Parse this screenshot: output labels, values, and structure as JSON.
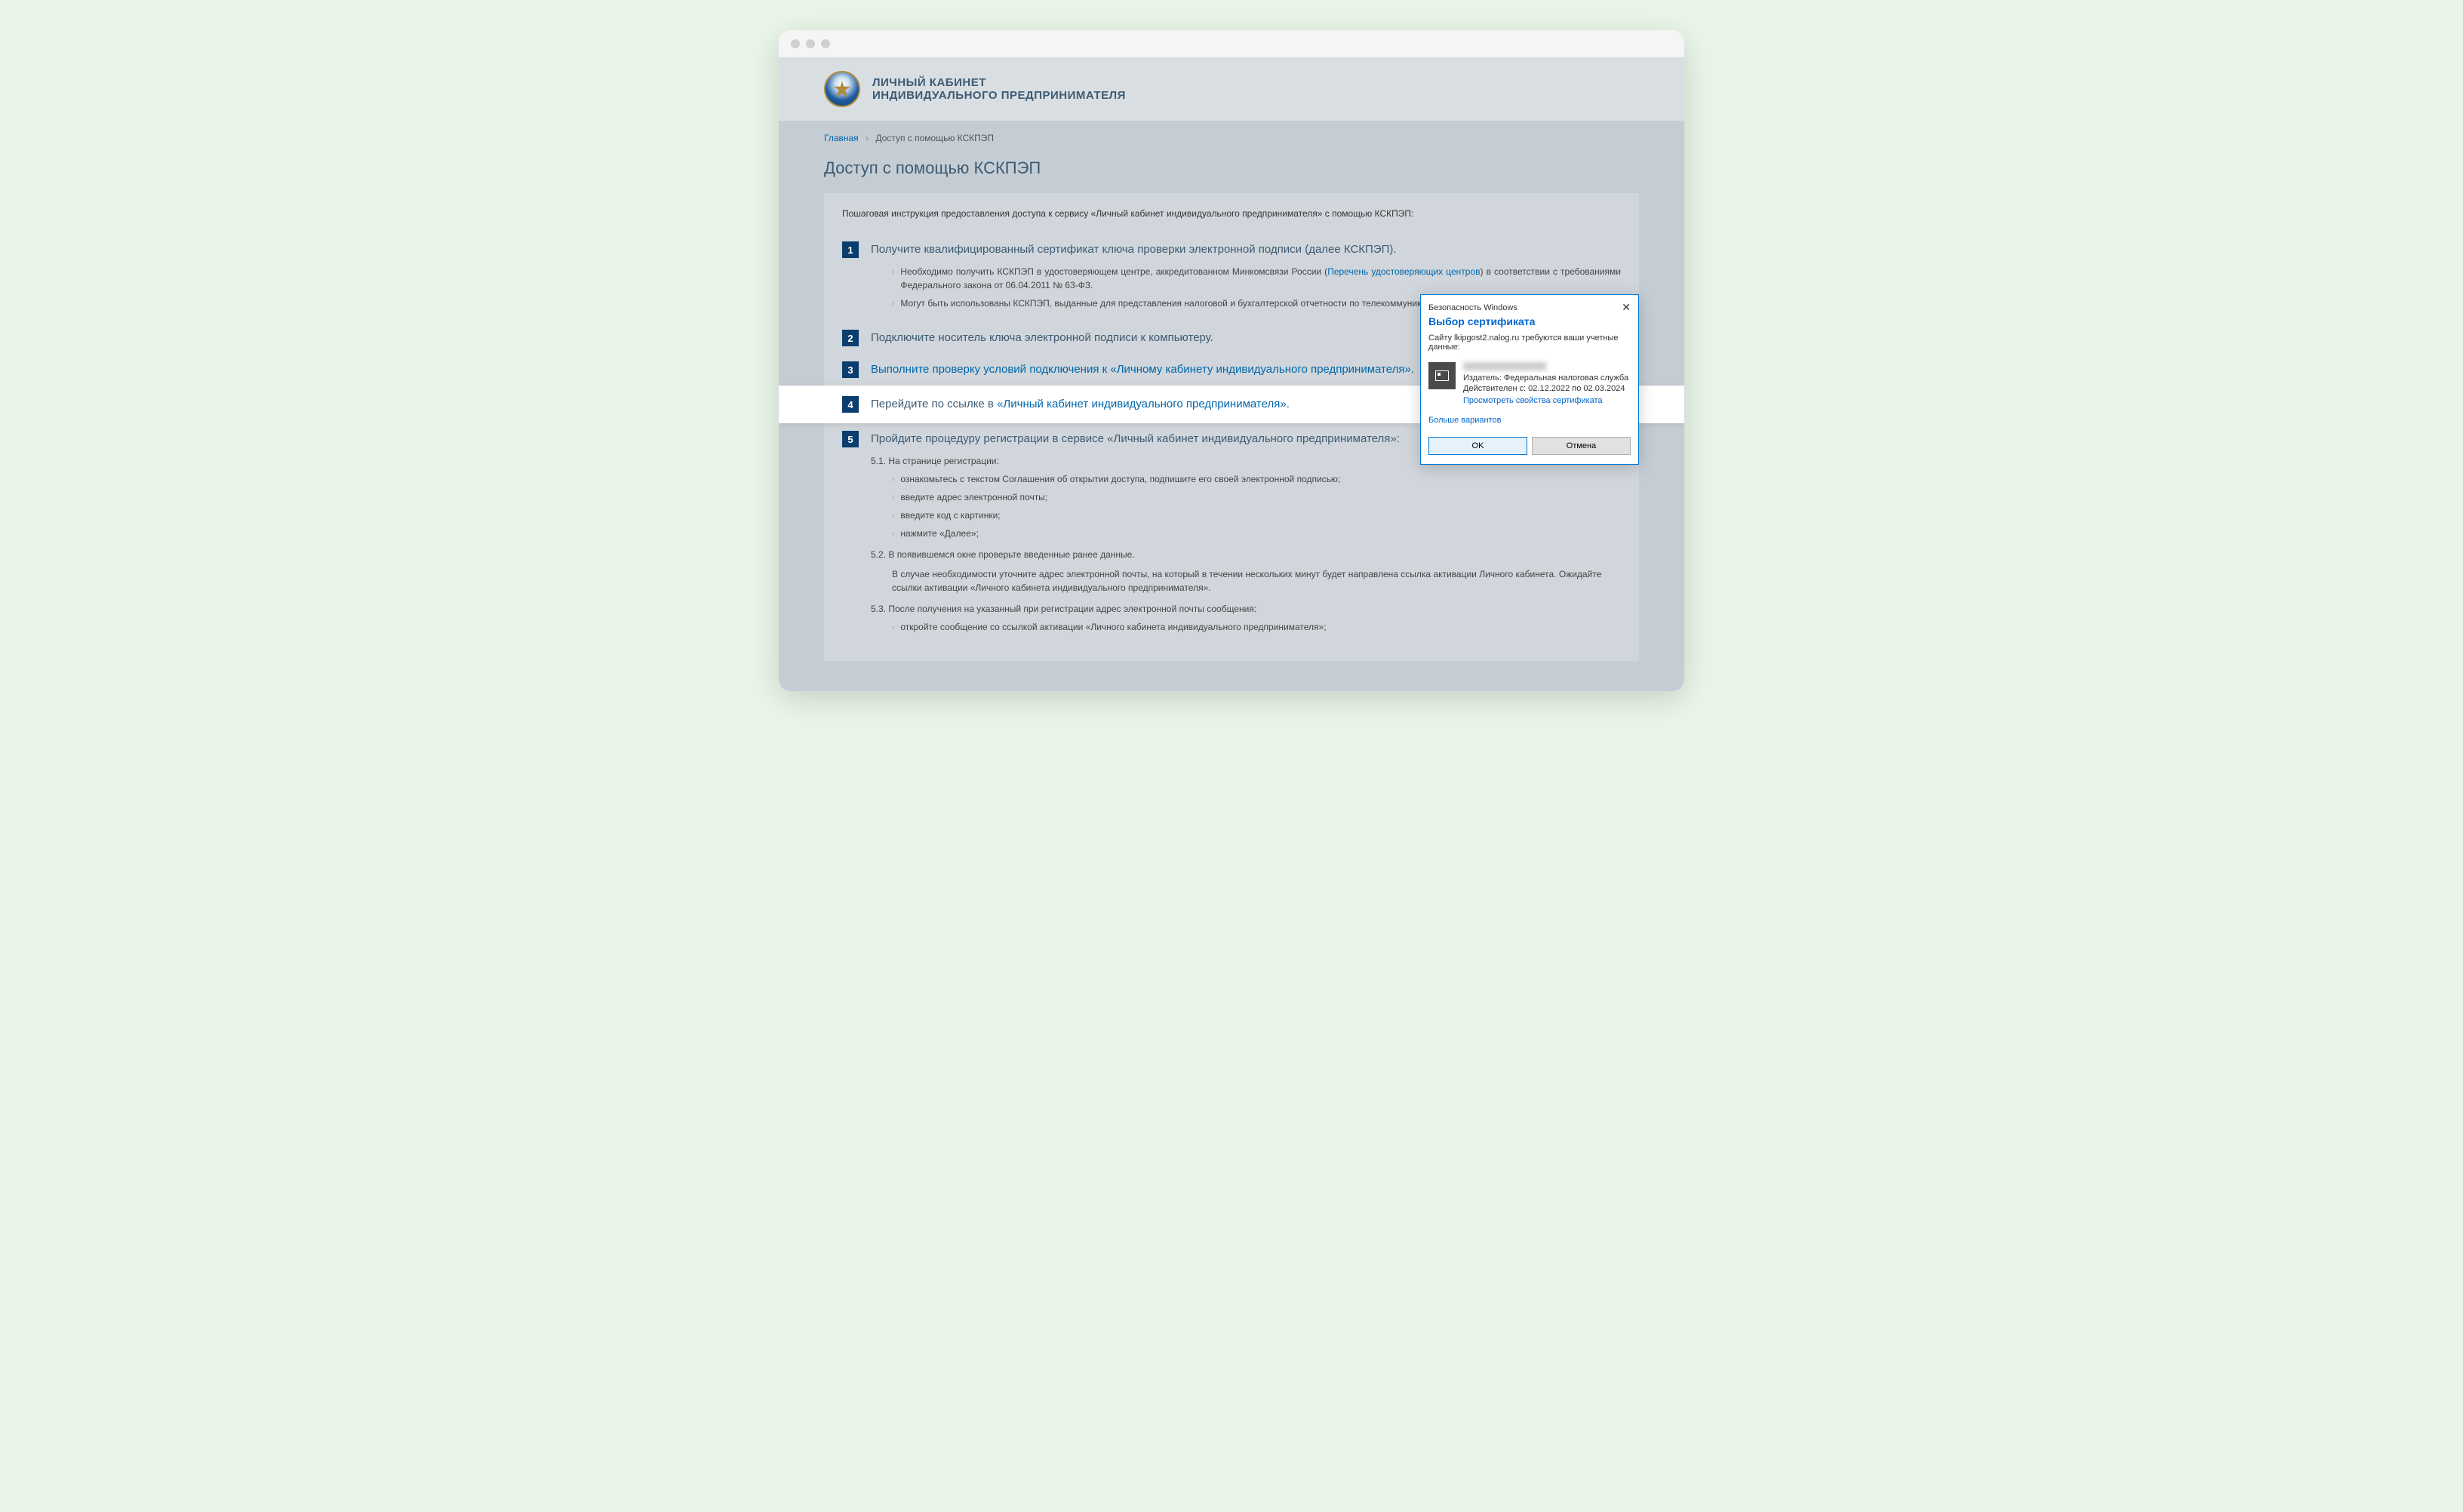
{
  "header": {
    "line1": "ЛИЧНЫЙ КАБИНЕТ",
    "line2": "ИНДИВИДУАЛЬНОГО ПРЕДПРИНИМАТЕЛЯ"
  },
  "breadcrumb": {
    "home": "Главная",
    "current": "Доступ с помощью КСКПЭП"
  },
  "page_title": "Доступ с помощью КСКПЭП",
  "intro": "Пошаговая инструкция предоставления доступа к сервису «Личный кабинет индивидуального предпринимателя» с помощью КСКПЭП:",
  "steps": {
    "s1": {
      "num": "1",
      "title": "Получите квалифицированный сертификат ключа проверки электронной подписи (далее КСКПЭП).",
      "sub1_before": "Необходимо получить КСКПЭП в удостоверяющем центре, аккредитованном Минкомсвязи России (",
      "sub1_link": "Перечень удостоверяющих центров",
      "sub1_after": ") в соответствии с требованиями Федерального закона от 06.04.2011 № 63-ФЗ.",
      "sub2": "Могут быть использованы КСКПЭП, выданные для представления налоговой и бухгалтерской отчетности по телекоммуникационным каналам связи."
    },
    "s2": {
      "num": "2",
      "title": "Подключите носитель ключа электронной подписи к компьютеру."
    },
    "s3": {
      "num": "3",
      "title_before": "Выполните проверку условий подключения к ",
      "title_link": "«Личному кабинету индивидуального предпринимателя»",
      "title_after": "."
    },
    "s4": {
      "num": "4",
      "title_before": "Перейдите по ссылке в ",
      "title_link": "«Личный кабинет индивидуального предпринимателя»",
      "title_after": "."
    },
    "s5": {
      "num": "5",
      "title": "Пройдите процедуру регистрации в сервисе «Личный кабинет индивидуального предпринимателя»:",
      "p51": "5.1. На странице регистрации:",
      "i1": "ознакомьтесь с текстом Соглашения об открытии доступа, подпишите его своей электронной подписью;",
      "i2": "введите адрес электронной почты;",
      "i3": "введите код с картинки;",
      "i4": "нажмите «Далее»;",
      "p52": "5.2. В появившемся окне проверьте введенные ранее данные.",
      "p52b": "В случае необходимости уточните адрес электронной почты, на который в течении нескольких минут будет направлена ссылка активации Личного кабинета. Ожидайте ссылки активации «Личного кабинета индивидуального предпринимателя».",
      "p53": "5.3. После получения на указанный при регистрации адрес электронной почты сообщения:",
      "i5": "откройте сообщение со ссылкой активации «Личного кабинета индивидуального предпринимателя»;"
    }
  },
  "dialog": {
    "security": "Безопасность Windows",
    "title": "Выбор сертификата",
    "msg": "Сайту lkipgost2.nalog.ru требуются ваши учетные данные:",
    "issuer": "Издатель: Федеральная налоговая служба",
    "valid": "Действителен с: 02.12.2022 по 02.03.2024",
    "view_props": "Просмотреть свойства сертификата",
    "more": "Больше вариантов",
    "ok": "OK",
    "cancel": "Отмена"
  }
}
